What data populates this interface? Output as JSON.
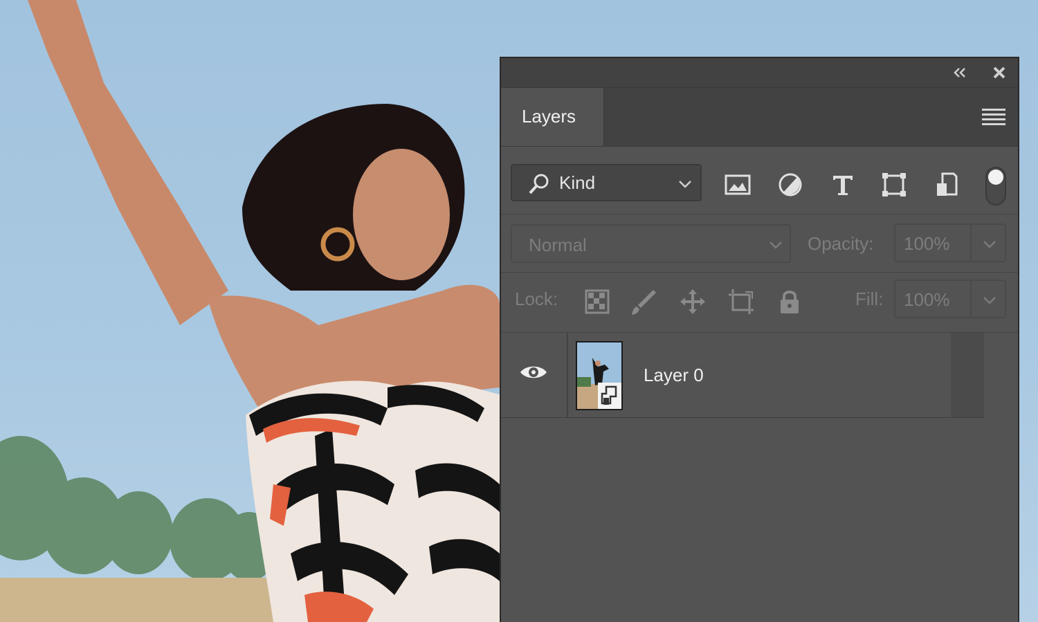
{
  "window": {
    "title_bar": {
      "collapse_icon": "double-chevron-left-icon",
      "close_icon": "close-icon"
    },
    "tab": {
      "label": "Layers"
    },
    "menu_icon": "hamburger-menu-icon"
  },
  "filter": {
    "kind_label": "Kind",
    "icons": [
      "image-filter-icon",
      "adjustment-filter-icon",
      "type-filter-icon",
      "shape-filter-icon",
      "smart-object-filter-icon"
    ],
    "toggle_on": true
  },
  "blend": {
    "mode": "Normal",
    "opacity_label": "Opacity:",
    "opacity_value": "100%"
  },
  "lock": {
    "label": "Lock:",
    "icons": [
      "lock-transparent-pixels-icon",
      "lock-image-pixels-icon",
      "lock-position-icon",
      "lock-artboard-icon",
      "lock-all-icon"
    ],
    "fill_label": "Fill:",
    "fill_value": "100%"
  },
  "layers": [
    {
      "name": "Layer 0",
      "visible": true,
      "smart_object": true
    }
  ],
  "colors": {
    "panel_bg": "#535353",
    "title_bg": "#424242",
    "text_light": "#f0f0f0",
    "text_dim": "#7d7d7d"
  }
}
